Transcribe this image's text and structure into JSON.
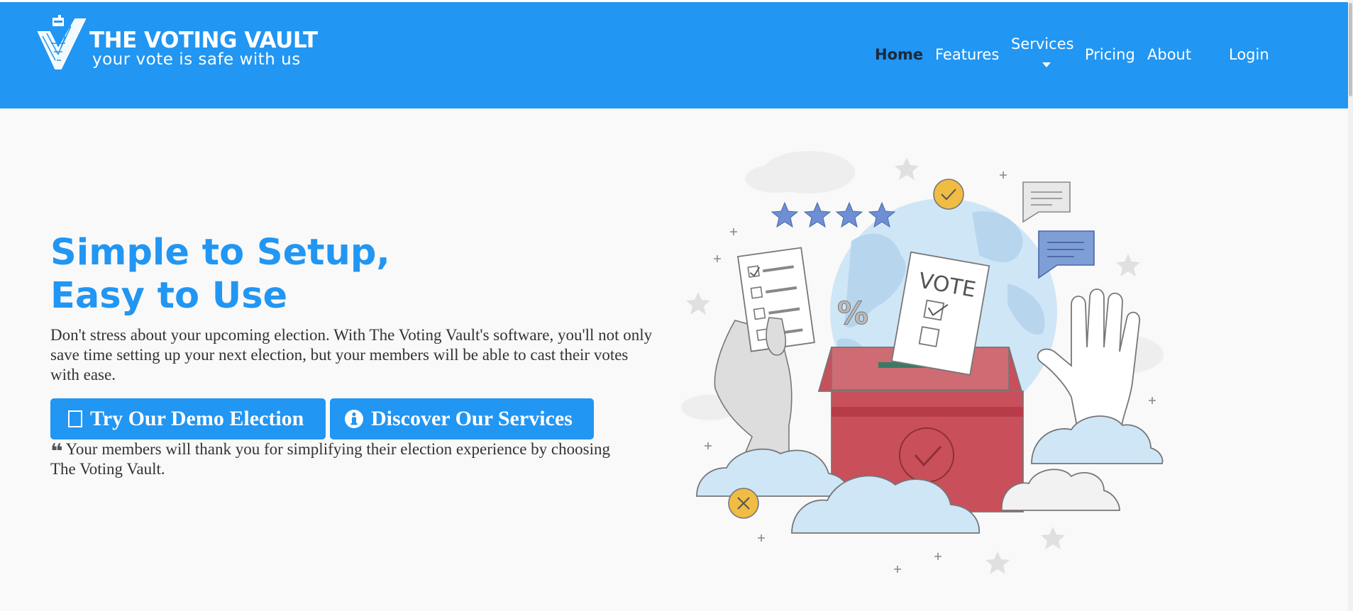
{
  "brand": {
    "title": "THE VOTING VAULT",
    "tagline": "your vote is safe with us",
    "logo_icon": "check-ballot-icon"
  },
  "nav": {
    "items": [
      {
        "label": "Home",
        "active": true
      },
      {
        "label": "Features"
      },
      {
        "label": "Services",
        "has_dropdown": true
      },
      {
        "label": "Pricing"
      },
      {
        "label": "About"
      },
      {
        "label": "Login"
      }
    ]
  },
  "hero": {
    "title_line1": "Simple to Setup,",
    "title_line2": "Easy to Use",
    "description": "Don't stress about your upcoming election. With The Voting Vault's software, you'll not only save time setting up your next election, but your members will be able to cast their votes with ease.",
    "buttons": {
      "demo": {
        "label": "Try Our Demo Election",
        "icon": "ballot-icon"
      },
      "services": {
        "label": "Discover Our Services",
        "icon": "info-circle-icon"
      }
    },
    "testimonial": "Your members will thank you for simplifying their election experience by choosing The Voting Vault.",
    "testimonial_icon": "quote-left-icon"
  },
  "illustration": {
    "ballot_text": "VOTE",
    "percent_symbol": "%",
    "star_rating": 4
  },
  "colors": {
    "primary": "#2196f3",
    "active_nav": "#1a2a3a",
    "text": "#333333",
    "background": "#f9f9f9",
    "ballot_box": "#c94f5a",
    "globe": "#cfe6f7",
    "badge": "#f0bc43",
    "star": "#6f8fd4"
  }
}
